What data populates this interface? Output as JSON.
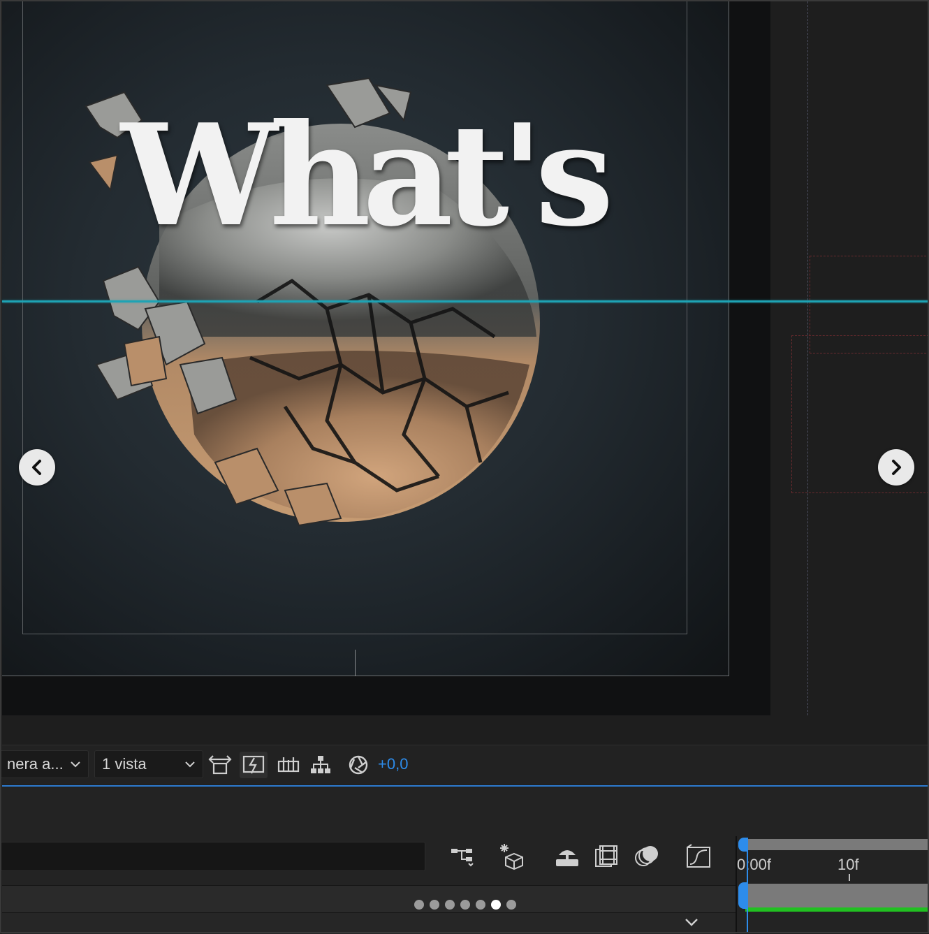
{
  "viewer": {
    "title_text": "What's"
  },
  "viewer_toolbar": {
    "camera_dropdown": "nera a...",
    "views_dropdown": "1 vista",
    "exposure_value": "+0,0"
  },
  "timeline": {
    "ruler_labels": [
      "0:00f",
      "10f"
    ]
  },
  "carousel": {
    "dot_count": 7,
    "active_dot_index": 5
  },
  "colors": {
    "guide": "#1ea3b4",
    "accent_blue": "#2d8ceb",
    "work_area_green": "#21c021"
  }
}
